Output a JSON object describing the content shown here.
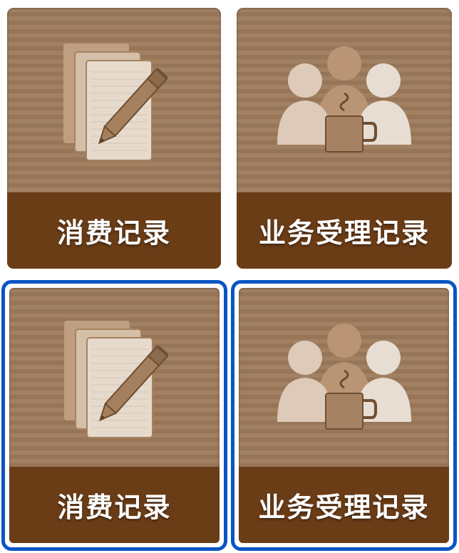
{
  "tiles": [
    {
      "label": "消费记录",
      "icon": "documents-pencil-icon",
      "state": "normal"
    },
    {
      "label": "业务受理记录",
      "icon": "people-coffee-icon",
      "state": "normal"
    },
    {
      "label": "消费记录",
      "icon": "documents-pencil-icon",
      "state": "focused"
    },
    {
      "label": "业务受理记录",
      "icon": "people-coffee-icon",
      "state": "focused"
    }
  ],
  "colors": {
    "tile_bg": "#9d7a5b",
    "caption_bg": "#6b3d17",
    "focus_border": "#0a55c4",
    "icon_light": "#e6d9cc",
    "icon_mid": "#c7a98c"
  }
}
